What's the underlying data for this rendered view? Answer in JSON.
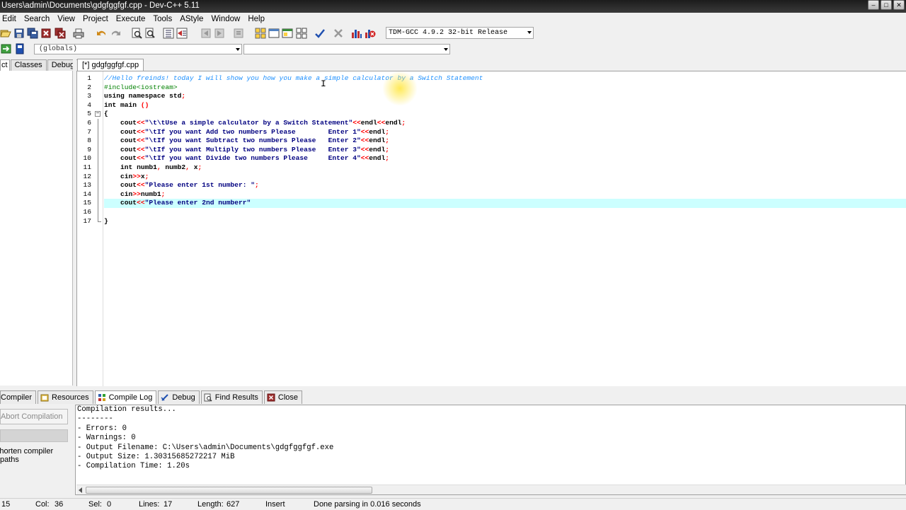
{
  "window": {
    "title": "Users\\admin\\Documents\\gdgfggfgf.cpp - Dev-C++ 5.11"
  },
  "menu": [
    "Edit",
    "Search",
    "View",
    "Project",
    "Execute",
    "Tools",
    "AStyle",
    "Window",
    "Help"
  ],
  "toolbar": {
    "compiler": "TDM-GCC 4.9.2 32-bit Release",
    "scope_select": "(globals)",
    "function_select": ""
  },
  "left_tabs": [
    "ct",
    "Classes",
    "Debug"
  ],
  "editor": {
    "tab_label": "[*] gdgfggfgf.cpp",
    "lines": [
      {
        "n": "1",
        "text": "//Hello freinds! today I will show you how you make a simple calculator by a Switch Statement"
      },
      {
        "n": "2",
        "text": "#include<iostream>"
      },
      {
        "n": "3",
        "text": "using namespace std;"
      },
      {
        "n": "4",
        "text": "int main ()"
      },
      {
        "n": "5",
        "text": "{"
      },
      {
        "n": "6",
        "text": "    cout<<\"\\t\\tUse a simple calculator by a Switch Statement\"<<endl<<endl;"
      },
      {
        "n": "7",
        "text": "    cout<<\"\\tIf you want Add two numbers Please        Enter 1\"<<endl;"
      },
      {
        "n": "8",
        "text": "    cout<<\"\\tIf you want Subtract two numbers Please   Enter 2\"<<endl;"
      },
      {
        "n": "9",
        "text": "    cout<<\"\\tIf you want Multiply two numbers Please   Enter 3\"<<endl;"
      },
      {
        "n": "10",
        "text": "    cout<<\"\\tIf you want Divide two numbers Please     Enter 4\"<<endl;"
      },
      {
        "n": "11",
        "text": "    int numb1, numb2, x;"
      },
      {
        "n": "12",
        "text": "    cin>>x;"
      },
      {
        "n": "13",
        "text": "    cout<<\"Please enter 1st number: \";"
      },
      {
        "n": "14",
        "text": "    cin>>numb1;"
      },
      {
        "n": "15",
        "text": "    cout<<\"Please enter 2nd numberr\""
      },
      {
        "n": "16",
        "text": ""
      },
      {
        "n": "17",
        "text": "}"
      }
    ],
    "current_line": 15
  },
  "bottom_tabs": [
    {
      "label": "Compiler",
      "icon": "compiler-icon"
    },
    {
      "label": "Resources",
      "icon": "resources-icon"
    },
    {
      "label": "Compile Log",
      "icon": "compile-log-icon"
    },
    {
      "label": "Debug",
      "icon": "debug-icon"
    },
    {
      "label": "Find Results",
      "icon": "find-results-icon"
    },
    {
      "label": "Close",
      "icon": "close-icon"
    }
  ],
  "bottom_left": {
    "abort_label": "Abort Compilation",
    "short_paths_label": "Shorten compiler paths"
  },
  "compile_log": [
    "Compilation results...",
    "--------",
    "- Errors: 0",
    "- Warnings: 0",
    "- Output Filename: C:\\Users\\admin\\Documents\\gdgfggfgf.exe",
    "- Output Size: 1.30315685272217 MiB",
    "- Compilation Time: 1.20s"
  ],
  "status": {
    "line": "15",
    "col_label": "Col:",
    "col": "36",
    "sel_label": "Sel:",
    "sel": "0",
    "lines_label": "Lines:",
    "lines": "17",
    "length_label": "Length:",
    "length": "627",
    "mode": "Insert",
    "message": "Done parsing in 0.016 seconds"
  },
  "colors": {
    "comment": "#1e90ff",
    "preprocessor": "#008000",
    "string": "#000080",
    "operator": "#ff0000",
    "current_line": "#ccffff"
  }
}
